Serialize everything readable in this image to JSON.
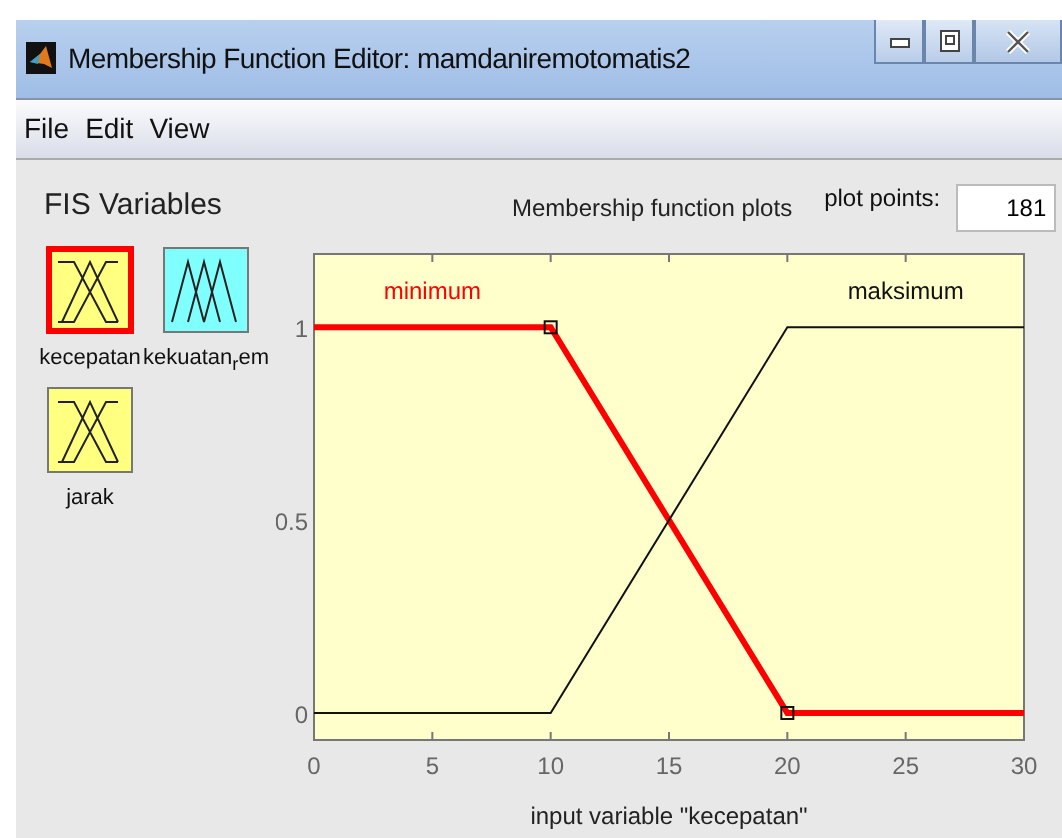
{
  "window": {
    "title": "Membership Function Editor: mamdaniremotomatis2"
  },
  "menu": [
    "File",
    "Edit",
    "View"
  ],
  "fis_variables": {
    "title": "FIS Variables",
    "variables": [
      {
        "name": "kecepatan",
        "kind": "input",
        "selected": true
      },
      {
        "name": "kekuatan$_{r}$em",
        "kind": "output",
        "selected": false
      },
      {
        "name": "jarak",
        "kind": "input",
        "selected": false
      }
    ]
  },
  "plots_label": "Membership function plots",
  "plot_points": {
    "label": "plot points:",
    "value": "181"
  },
  "chart_data": {
    "type": "line",
    "xlabel": "input variable \"kecepatan\"",
    "x": [
      0,
      10,
      20,
      30
    ],
    "series": [
      {
        "name": "minimum",
        "color": "#ff0000",
        "values": [
          1,
          1,
          0,
          0
        ]
      },
      {
        "name": "maksimum",
        "color": "#111111",
        "values": [
          0,
          0,
          1,
          1
        ]
      }
    ],
    "xlim": [
      0,
      30
    ],
    "ylim": [
      -0.07,
      1.19
    ],
    "xticks": [
      0,
      5,
      10,
      15,
      20,
      25,
      30
    ],
    "yticks": [
      0,
      0.5,
      1
    ]
  }
}
